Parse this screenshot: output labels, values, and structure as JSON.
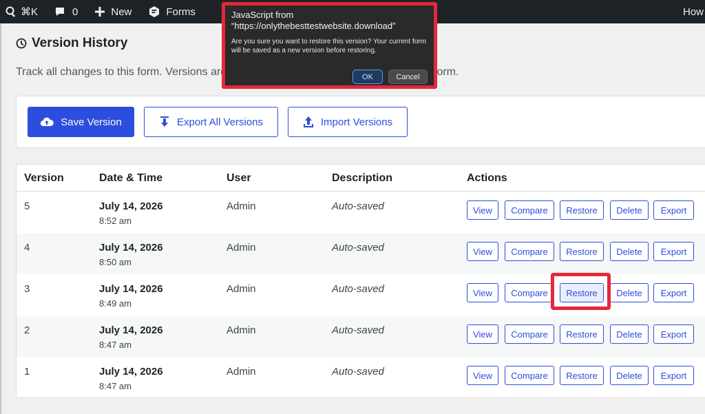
{
  "adminbar": {
    "search_shortcut": "⌘K",
    "comments_count": "0",
    "new_label": "New",
    "forms_label": "Forms",
    "right_label": "How"
  },
  "page": {
    "title": "Version History",
    "description_start": "Track all changes to this form. Versions are",
    "description_end": "form."
  },
  "toolbar": {
    "save_label": "Save Version",
    "export_all_label": "Export All Versions",
    "import_label": "Import Versions"
  },
  "table": {
    "headers": {
      "version": "Version",
      "datetime": "Date & Time",
      "user": "User",
      "description": "Description",
      "actions": "Actions"
    },
    "action_labels": {
      "view": "View",
      "compare": "Compare",
      "restore": "Restore",
      "delete": "Delete",
      "export": "Export"
    },
    "rows": [
      {
        "version": "5",
        "date": "July 14, 2026",
        "time": "8:52 am",
        "user": "Admin",
        "description": "Auto-saved"
      },
      {
        "version": "4",
        "date": "July 14, 2026",
        "time": "8:50 am",
        "user": "Admin",
        "description": "Auto-saved"
      },
      {
        "version": "3",
        "date": "July 14, 2026",
        "time": "8:49 am",
        "user": "Admin",
        "description": "Auto-saved"
      },
      {
        "version": "2",
        "date": "July 14, 2026",
        "time": "8:47 am",
        "user": "Admin",
        "description": "Auto-saved"
      },
      {
        "version": "1",
        "date": "July 14, 2026",
        "time": "8:47 am",
        "user": "Admin",
        "description": "Auto-saved"
      }
    ]
  },
  "dialog": {
    "title_line1": "JavaScript from",
    "title_line2": "“https://onlythebesttestwebsite.download”",
    "message": "Are you sure you want to restore this version? Your current form will be saved as a new version before restoring.",
    "ok_label": "OK",
    "cancel_label": "Cancel"
  },
  "colors": {
    "accent": "#2c4dde",
    "highlight_frame": "#e5283a",
    "adminbar_bg": "#1d2327"
  }
}
